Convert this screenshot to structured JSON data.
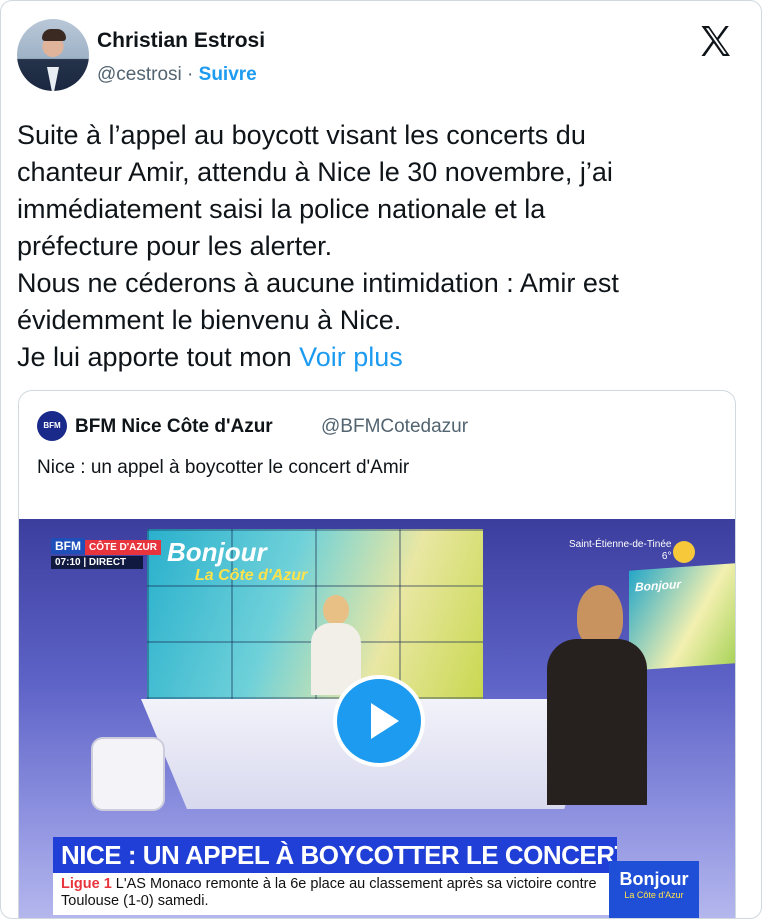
{
  "author": {
    "name": "Christian Estrosi",
    "handle": "@cestrosi",
    "separator": "·",
    "follow_label": "Suivre"
  },
  "tweet": {
    "text": "Suite à l’appel au boycott visant les concerts du\nchanteur Amir, attendu à Nice le 30 novembre, j’ai\nimmédiatement saisi la police nationale et la\npréfecture pour les alerter.\nNous ne céderons à aucune intimidation : Amir est\névidemment le bienvenu à Nice.\nJe lui apporte tout mon ",
    "show_more_label": "Voir plus"
  },
  "quote": {
    "avatar_text": "BFM",
    "name": "BFM Nice Côte d'Azur",
    "handle": "@BFMCotedazur",
    "text": "Nice : un appel à boycotter le concert d'Amir"
  },
  "video": {
    "logo_bfm": "BFM",
    "logo_region": "CÔTE D'AZUR",
    "logo_time": "07:10 | DIRECT",
    "screen_title": "Bonjour",
    "screen_subtitle": "La Côte d'Azur",
    "weather_city": "Saint-Étienne-de-Tinée",
    "weather_temp": "6°",
    "side_screen_title": "Bonjour",
    "headline": "NICE : UN APPEL À BOYCOTTER LE CONCERT D'AMIR",
    "ticker_league": "Ligue 1",
    "ticker_text": " L'AS Monaco remonte à la 6e place au classement après sa victoire contre Toulouse (1-0) samedi.",
    "corner_title": "Bonjour",
    "corner_subtitle": "La Côte d'Azur"
  },
  "icons": {
    "x_logo": "x-logo-icon",
    "play": "play-icon"
  },
  "colors": {
    "link": "#1d9bf0",
    "headline_bar": "#1f3fd6",
    "ticker_league": "#e8353d"
  }
}
